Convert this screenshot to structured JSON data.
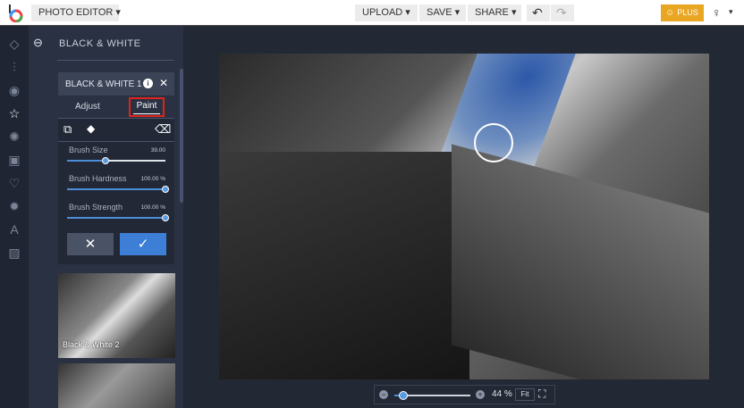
{
  "header": {
    "app_menu": "PHOTO EDITOR ▾",
    "upload": "UPLOAD ▾",
    "save": "SAVE ▾",
    "share": "SHARE ▾",
    "undo": "↶",
    "redo": "↷",
    "plus": "PLUS",
    "account_caret": "▾"
  },
  "panel": {
    "title": "BLACK & WHITE",
    "card_title": "BLACK & WHITE 1",
    "tabs": [
      "Adjust",
      "Paint"
    ],
    "active_tab": "Paint",
    "sliders": [
      {
        "label": "Brush Size",
        "value_text": "39.00",
        "fraction": 0.39
      },
      {
        "label": "Brush Hardness",
        "value_text": "100.00 %",
        "fraction": 1.0
      },
      {
        "label": "Brush Strength",
        "value_text": "100.00 %",
        "fraction": 1.0
      }
    ],
    "presets": [
      "Black & White 2"
    ]
  },
  "zoom": {
    "value": "44 %",
    "fit": "Fit",
    "fraction": 0.12
  },
  "colors": {
    "accent": "#3d7fd6",
    "highlight": "#e0241b",
    "plus": "#e9a623"
  }
}
